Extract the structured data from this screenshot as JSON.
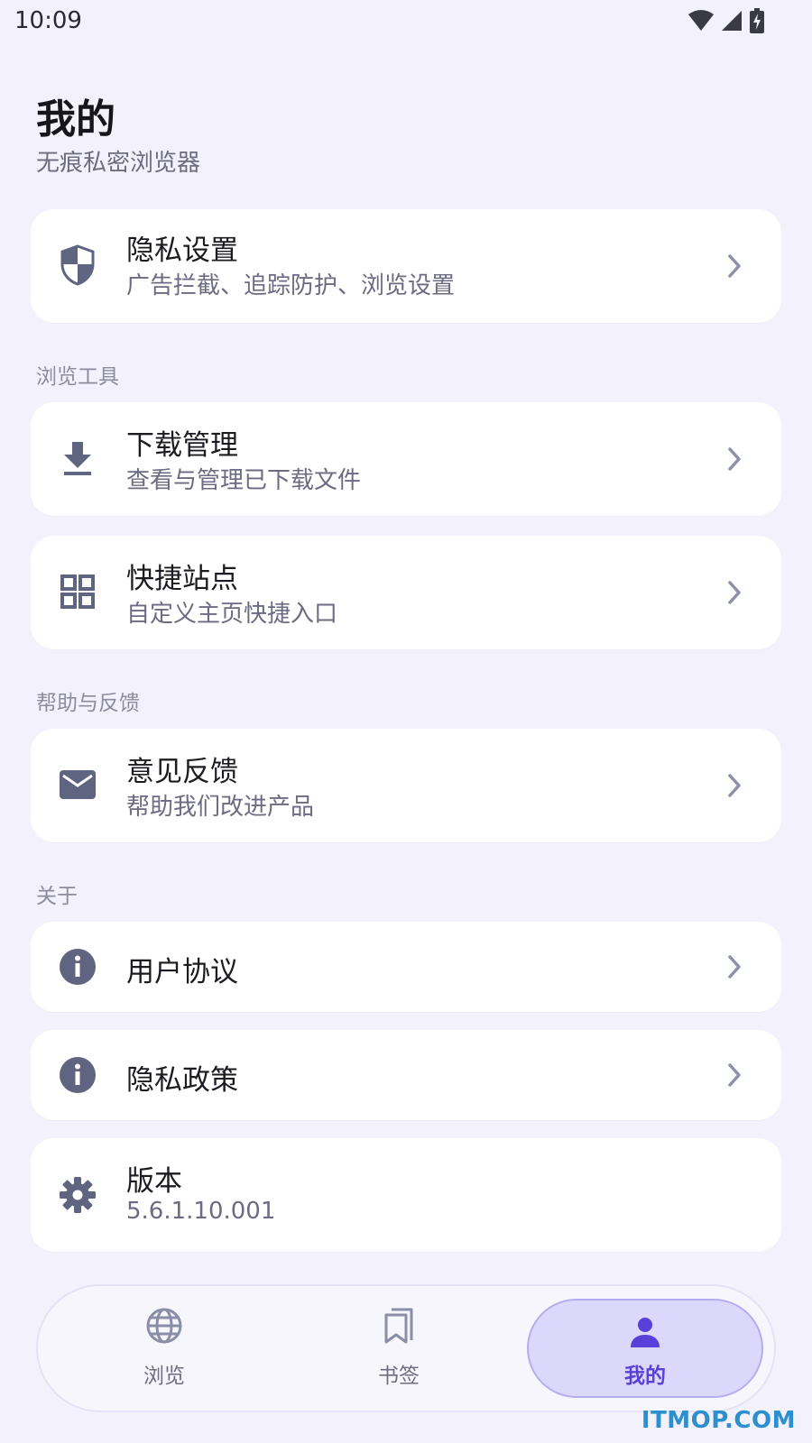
{
  "status": {
    "time": "10:09"
  },
  "header": {
    "title": "我的",
    "subtitle": "无痕私密浏览器"
  },
  "privacy": {
    "title": "隐私设置",
    "subtitle": "广告拦截、追踪防护、浏览设置",
    "icon": "shield-icon"
  },
  "sections": {
    "tools": "浏览工具",
    "help": "帮助与反馈",
    "about": "关于"
  },
  "tools": {
    "download": {
      "title": "下载管理",
      "subtitle": "查看与管理已下载文件",
      "icon": "download-icon"
    },
    "shortcuts": {
      "title": "快捷站点",
      "subtitle": "自定义主页快捷入口",
      "icon": "grid-icon"
    }
  },
  "help": {
    "feedback": {
      "title": "意见反馈",
      "subtitle": "帮助我们改进产品",
      "icon": "mail-icon"
    }
  },
  "about": {
    "agreement": {
      "title": "用户协议",
      "icon": "info-icon"
    },
    "policy": {
      "title": "隐私政策",
      "icon": "info-icon"
    },
    "version": {
      "title": "版本",
      "value": "5.6.1.10.001",
      "icon": "gear-icon"
    }
  },
  "nav": {
    "browse": "浏览",
    "bookmarks": "书签",
    "mine": "我的"
  },
  "colors": {
    "accent": "#5840d8",
    "icon": "#5f6480",
    "background": "#f3f2fc"
  },
  "watermark": "ITMOP.COM"
}
